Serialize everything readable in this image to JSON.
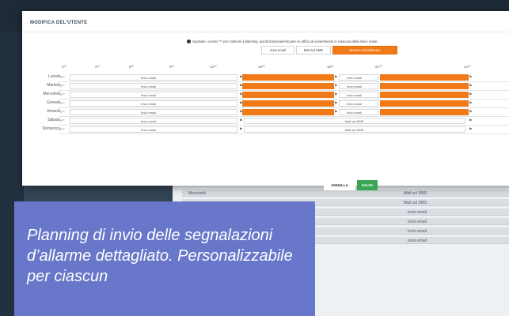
{
  "modal": {
    "title": "MODIFICA DEL'UTENTE",
    "help_text": "Spostare i cursori “•” per costruire il planning, quindi trascinare/cliccare un ufficio di avvertimento in ciascuna delle fasce orarie.",
    "mode_buttons": [
      "Invio email",
      "Mail sul SMS",
      "Nessun avvertimento"
    ],
    "active_mode": "Nessun avvertimento",
    "hours": [
      "0⁰⁰",
      "3⁰⁰",
      "6⁰⁰",
      "9⁰⁰",
      "12⁰⁰",
      "15⁰⁰",
      "18⁰⁰",
      "21⁰⁰",
      "24⁰⁰"
    ],
    "tick_label": "0⁰⁰",
    "segment_label": "Invio email",
    "days": [
      {
        "name": "Lunedi",
        "type": "weekday"
      },
      {
        "name": "Martedi",
        "type": "weekday"
      },
      {
        "name": "Mercoledi",
        "type": "weekday"
      },
      {
        "name": "Giovedi",
        "type": "weekday"
      },
      {
        "name": "Venerdi",
        "type": "weekday"
      },
      {
        "name": "Sabato",
        "type": "weekend"
      },
      {
        "name": "Domenica",
        "type": "weekend"
      }
    ],
    "weekend_mid_label": "Mail sul SMS",
    "cancel_label": "ANNULLA",
    "save_label": "SALVA",
    "colors": {
      "orange": "#f07a18",
      "save": "#3aa655",
      "caption_bg": "#6877c9"
    }
  },
  "background": {
    "row_day": "Mercoledi",
    "row_value": "Mail sul SMS",
    "row_email": "Invio email"
  },
  "caption": {
    "text": "Planning di invio delle segnalazioni d’allarme dettagliato. Personalizzabile per ciascun"
  }
}
